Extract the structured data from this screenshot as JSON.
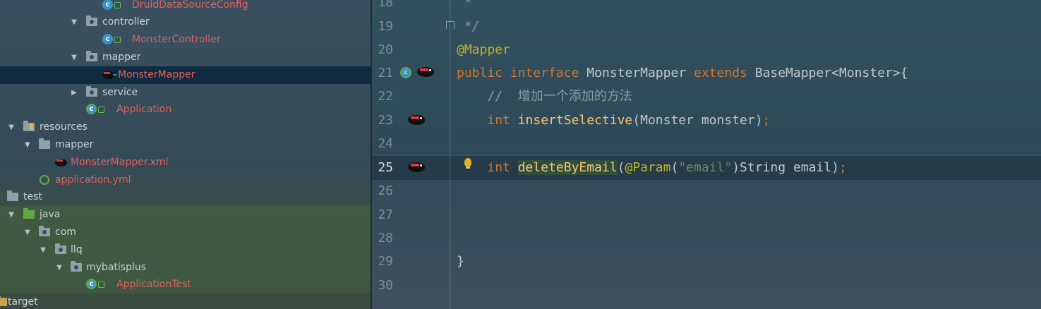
{
  "tree": {
    "items": [
      {
        "label": "DruidDataSourceConfig",
        "kind": "class",
        "depth": 6,
        "arrow": "",
        "red": true
      },
      {
        "label": "controller",
        "kind": "package",
        "depth": 5,
        "arrow": "▼",
        "red": false
      },
      {
        "label": "MonsterController",
        "kind": "class",
        "depth": 6,
        "arrow": "",
        "red": true
      },
      {
        "label": "mapper",
        "kind": "package",
        "depth": 5,
        "arrow": "▼",
        "red": false
      },
      {
        "label": "MonsterMapper",
        "kind": "mapper",
        "depth": 6,
        "arrow": "",
        "red": true,
        "selected": true
      },
      {
        "label": "service",
        "kind": "package",
        "depth": 5,
        "arrow": "▶",
        "red": false
      },
      {
        "label": "Application",
        "kind": "app-class",
        "depth": 5,
        "arrow": "",
        "red": true
      },
      {
        "label": "resources",
        "kind": "resources",
        "depth": 1,
        "arrow": "▼",
        "red": false
      },
      {
        "label": "mapper",
        "kind": "folder",
        "depth": 2,
        "arrow": "▼",
        "red": false
      },
      {
        "label": "MonsterMapper.xml",
        "kind": "xml",
        "depth": 3,
        "arrow": "",
        "red": true
      },
      {
        "label": "application.yml",
        "kind": "yml",
        "depth": 2,
        "arrow": "",
        "red": true
      },
      {
        "label": "test",
        "kind": "folder",
        "depth": 0,
        "arrow": "",
        "red": false
      },
      {
        "label": "java",
        "kind": "source-folder",
        "depth": 1,
        "arrow": "▼",
        "red": false
      },
      {
        "label": "com",
        "kind": "package",
        "depth": 2,
        "arrow": "▼",
        "red": false
      },
      {
        "label": "llq",
        "kind": "package",
        "depth": 3,
        "arrow": "▼",
        "red": false
      },
      {
        "label": "mybatisplus",
        "kind": "package",
        "depth": 4,
        "arrow": "▼",
        "red": false
      },
      {
        "label": "ApplicationTest",
        "kind": "app-class",
        "depth": 5,
        "arrow": "",
        "red": true
      },
      {
        "label": "target",
        "kind": "folder",
        "depth": 0,
        "arrow": "",
        "red": false
      }
    ]
  },
  "editor": {
    "current_line": 25,
    "lines": [
      {
        "num": "18",
        "text": " *"
      },
      {
        "num": "19",
        "text": " */"
      },
      {
        "num": "20",
        "text": "@Mapper"
      },
      {
        "num": "21",
        "text": "public interface MonsterMapper extends BaseMapper<Monster>{"
      },
      {
        "num": "22",
        "text": "    //  增加一个添加的方法"
      },
      {
        "num": "23",
        "text": "    int insertSelective(Monster monster);"
      },
      {
        "num": "24",
        "text": ""
      },
      {
        "num": "25",
        "text": "    int deleteByEmail(@Param(\"email\")String email);"
      },
      {
        "num": "26",
        "text": ""
      },
      {
        "num": "27",
        "text": ""
      },
      {
        "num": "28",
        "text": ""
      },
      {
        "num": "29",
        "text": "}"
      },
      {
        "num": "30",
        "text": ""
      }
    ]
  },
  "colors": {
    "keyword": "#cc7832",
    "annotation": "#bbb529",
    "method": "#ffc66d",
    "string": "#6a8759",
    "comment": "#8a9aa3",
    "vcs_modified_file": "#e0605c",
    "selection": "#0d293e"
  },
  "icons": {
    "class": "class-c-icon",
    "package": "package-folder-icon",
    "mapper": "mybatis-bird-icon",
    "implemented": "implemented-interface-icon",
    "intention": "lightbulb-icon"
  }
}
